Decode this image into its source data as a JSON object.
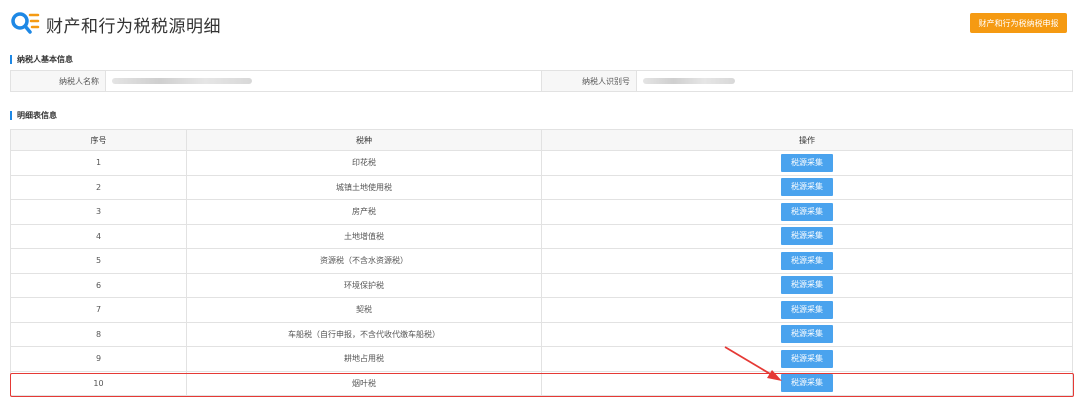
{
  "header": {
    "title": "财产和行为税税源明细",
    "declare_button": "财产和行为税纳税申报"
  },
  "taxpayer_section": {
    "title": "纳税人基本信息",
    "name_label": "纳税人名称",
    "id_label": "纳税人识别号"
  },
  "detail_section": {
    "title": "明细表信息",
    "columns": [
      "序号",
      "税种",
      "操作"
    ],
    "rows": [
      {
        "seq": "1",
        "tax": "印花税",
        "action": "税源采集"
      },
      {
        "seq": "2",
        "tax": "城镇土地使用税",
        "action": "税源采集"
      },
      {
        "seq": "3",
        "tax": "房产税",
        "action": "税源采集"
      },
      {
        "seq": "4",
        "tax": "土地增值税",
        "action": "税源采集"
      },
      {
        "seq": "5",
        "tax": "资源税（不含水资源税）",
        "action": "税源采集"
      },
      {
        "seq": "6",
        "tax": "环境保护税",
        "action": "税源采集"
      },
      {
        "seq": "7",
        "tax": "契税",
        "action": "税源采集"
      },
      {
        "seq": "8",
        "tax": "车船税（自行申报，不含代收代缴车船税）",
        "action": "税源采集"
      },
      {
        "seq": "9",
        "tax": "耕地占用税",
        "action": "税源采集"
      },
      {
        "seq": "10",
        "tax": "烟叶税",
        "action": "税源采集"
      }
    ]
  },
  "colors": {
    "accent_blue": "#4aa3ee",
    "orange": "#f59a12",
    "highlight_red": "#e53935"
  }
}
